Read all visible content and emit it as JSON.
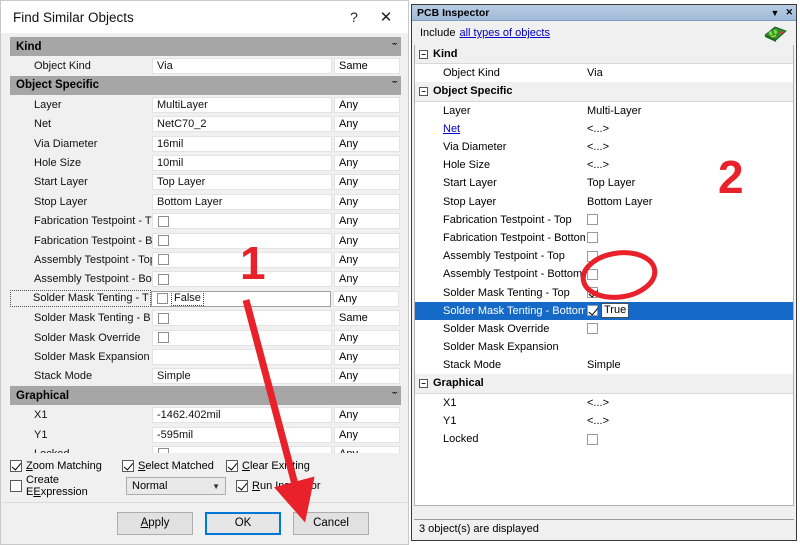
{
  "find_dialog": {
    "title": "Find Similar Objects",
    "help_btn": "?",
    "close_btn": "✕",
    "collapse_glyph": "ˇˇ",
    "groups": [
      {
        "name": "Kind",
        "rows": [
          {
            "label": "Object Kind",
            "value": "Via",
            "type": "text",
            "match": "Same"
          }
        ]
      },
      {
        "name": "Object Specific",
        "rows": [
          {
            "label": "Layer",
            "value": "MultiLayer",
            "type": "text",
            "match": "Any"
          },
          {
            "label": "Net",
            "value": "NetC70_2",
            "type": "text",
            "match": "Any"
          },
          {
            "label": "Via Diameter",
            "value": "16mil",
            "type": "text",
            "match": "Any"
          },
          {
            "label": "Hole Size",
            "value": "10mil",
            "type": "text",
            "match": "Any"
          },
          {
            "label": "Start Layer",
            "value": "Top Layer",
            "type": "text",
            "match": "Any"
          },
          {
            "label": "Stop Layer",
            "value": "Bottom Layer",
            "type": "text",
            "match": "Any"
          },
          {
            "label": "Fabrication Testpoint - T",
            "value": "",
            "type": "check",
            "checked": false,
            "match": "Any"
          },
          {
            "label": "Fabrication Testpoint - B",
            "value": "",
            "type": "check",
            "checked": false,
            "match": "Any"
          },
          {
            "label": "Assembly Testpoint - Top",
            "value": "",
            "type": "check",
            "checked": false,
            "match": "Any"
          },
          {
            "label": "Assembly Testpoint - Bot",
            "value": "",
            "type": "check",
            "checked": false,
            "match": "Any"
          },
          {
            "label": "Solder Mask Tenting - T",
            "value": "False",
            "type": "check-edit",
            "checked": false,
            "match": "Any",
            "focused": true
          },
          {
            "label": "Solder Mask Tenting - B",
            "value": "",
            "type": "check",
            "checked": false,
            "match": "Same"
          },
          {
            "label": "Solder Mask Override",
            "value": "",
            "type": "check",
            "checked": false,
            "match": "Any"
          },
          {
            "label": "Solder Mask Expansion",
            "value": "",
            "type": "text",
            "match": "Any"
          },
          {
            "label": "Stack Mode",
            "value": "Simple",
            "type": "text",
            "match": "Any"
          }
        ]
      },
      {
        "name": "Graphical",
        "rows": [
          {
            "label": "X1",
            "value": "-1462.402mil",
            "type": "text",
            "match": "Any"
          },
          {
            "label": "Y1",
            "value": "-595mil",
            "type": "text",
            "match": "Any"
          },
          {
            "label": "Locked",
            "value": "",
            "type": "check",
            "checked": false,
            "match": "Any"
          }
        ]
      }
    ],
    "options": {
      "zoom_matching": {
        "label_pre": "Z",
        "label_post": "oom Matching",
        "checked": true
      },
      "select_matched": {
        "label_pre": "S",
        "label_post": "elect Matched",
        "checked": true
      },
      "clear_existing": {
        "label_pre": "C",
        "label_post": "lear Existing",
        "checked": true
      },
      "create_expression": {
        "label_pre": "E",
        "label_pre2": "Create E",
        "label_post": "xpression",
        "checked": false
      },
      "run_inspector": {
        "label_pre": "R",
        "label_post": "un Inspector",
        "checked": true
      },
      "mode_select": {
        "value": "Normal",
        "arrow": "▼"
      }
    },
    "buttons": {
      "apply": {
        "pre": "A",
        "post": "pply"
      },
      "ok": "OK",
      "cancel": "Cancel"
    }
  },
  "inspector": {
    "title": "PCB Inspector",
    "minimize_glyph": "▼",
    "close_glyph": "✕",
    "include_label": "Include",
    "include_link": "all types of objects",
    "expand_glyph": "−",
    "groups": [
      {
        "name": "Kind",
        "rows": [
          {
            "label": "Object Kind",
            "value": "Via",
            "type": "text"
          }
        ]
      },
      {
        "name": "Object Specific",
        "rows": [
          {
            "label": "Layer",
            "value": "Multi-Layer",
            "type": "text"
          },
          {
            "label": "Net",
            "value": "<...>",
            "type": "link"
          },
          {
            "label": "Via Diameter",
            "value": "<...>",
            "type": "text"
          },
          {
            "label": "Hole Size",
            "value": "<...>",
            "type": "text"
          },
          {
            "label": "Start Layer",
            "value": "Top Layer",
            "type": "text"
          },
          {
            "label": "Stop Layer",
            "value": "Bottom Layer",
            "type": "text"
          },
          {
            "label": "Fabrication Testpoint - Top",
            "value": "",
            "type": "check",
            "checked": false
          },
          {
            "label": "Fabrication Testpoint - Bottom",
            "value": "",
            "type": "check",
            "checked": false
          },
          {
            "label": "Assembly Testpoint - Top",
            "value": "",
            "type": "check",
            "checked": false
          },
          {
            "label": "Assembly Testpoint - Bottom",
            "value": "",
            "type": "check",
            "checked": false
          },
          {
            "label": "Solder Mask Tenting - Top",
            "value": "",
            "type": "check",
            "checked": true
          },
          {
            "label": "Solder Mask Tenting - Bottom",
            "value": "True",
            "type": "check-edit",
            "checked": true,
            "selected": true
          },
          {
            "label": "Solder Mask Override",
            "value": "",
            "type": "check",
            "checked": false
          },
          {
            "label": "Solder Mask Expansion",
            "value": "",
            "type": "text"
          },
          {
            "label": "Stack Mode",
            "value": "Simple",
            "type": "text"
          }
        ]
      },
      {
        "name": "Graphical",
        "rows": [
          {
            "label": "X1",
            "value": "<...>",
            "type": "text"
          },
          {
            "label": "Y1",
            "value": "<...>",
            "type": "text"
          },
          {
            "label": "Locked",
            "value": "",
            "type": "check",
            "checked": false
          }
        ]
      }
    ],
    "status": "3 object(s) are displayed"
  },
  "annotations": {
    "step1": "1",
    "step2": "2",
    "color": "#e8212a"
  }
}
